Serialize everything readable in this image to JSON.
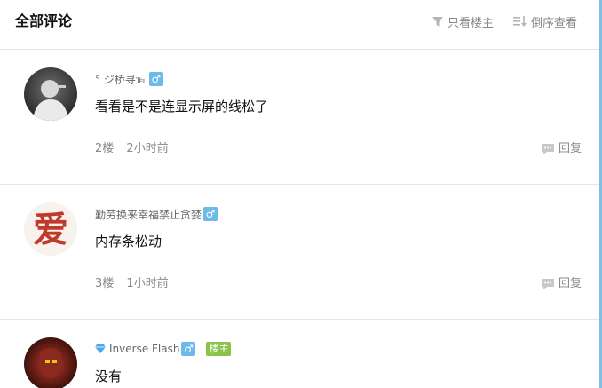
{
  "header": {
    "title": "全部评论",
    "host_only_label": "只看楼主",
    "reverse_order_label": "倒序查看"
  },
  "comments": [
    {
      "username": "° ジ桥寻℡",
      "gender": "♂",
      "text": "看看是不是连显示屏的线松了",
      "floor": "2楼",
      "time": "2小时前",
      "reply_label": "回复"
    },
    {
      "username": "勤劳换来幸福禁止贪婪",
      "gender": "♂",
      "text": "内存条松动",
      "floor": "3楼",
      "time": "1小时前",
      "reply_label": "回复"
    },
    {
      "username": "Inverse Flash",
      "gender": "♂",
      "badge": "楼主",
      "text": "没有"
    }
  ],
  "avatar_art": {
    "love_char": "爱"
  },
  "colors": {
    "gender_badge": "#6db9ea",
    "host_badge": "#8bc34a",
    "divider": "#e6e6e6",
    "muted_text": "#888888",
    "accent_rule": "#7cc1ea"
  }
}
